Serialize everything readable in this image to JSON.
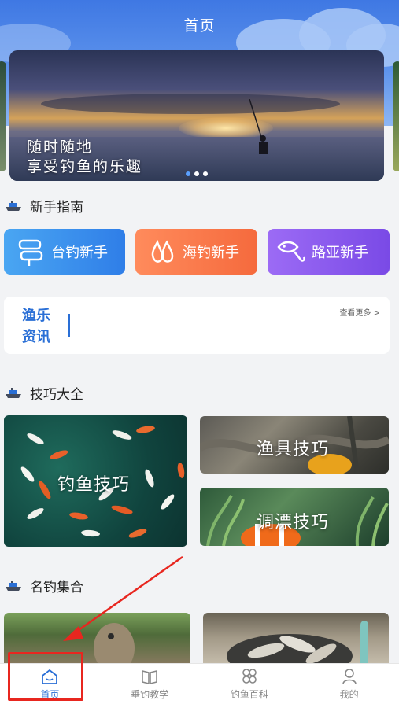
{
  "header": {
    "title": "首页"
  },
  "banner": {
    "line1": "随时随地",
    "line2": "享受钓鱼的乐趣",
    "pagination_count": 3,
    "active_index": 0
  },
  "sections": {
    "guide": {
      "title": "新手指南"
    },
    "skills": {
      "title": "技巧大全"
    },
    "famous": {
      "title": "名钓集合"
    }
  },
  "guide_buttons": [
    {
      "label": "台钓新手",
      "icon": "signpost-icon",
      "color": "#3a8ff0"
    },
    {
      "label": "海钓新手",
      "icon": "water-drops-icon",
      "color": "#f7794a"
    },
    {
      "label": "路亚新手",
      "icon": "fish-hook-icon",
      "color": "#8a5cf0"
    }
  ],
  "news": {
    "label": "渔乐资讯",
    "more": "查看更多 >"
  },
  "skill_tiles": [
    {
      "label": "钓鱼技巧"
    },
    {
      "label": "渔具技巧"
    },
    {
      "label": "调漂技巧"
    }
  ],
  "tabbar": {
    "items": [
      {
        "label": "首页",
        "icon": "home-icon",
        "active": true
      },
      {
        "label": "垂钓教学",
        "icon": "book-icon",
        "active": false
      },
      {
        "label": "钓鱼百科",
        "icon": "grid-icon",
        "active": false
      },
      {
        "label": "我的",
        "icon": "user-icon",
        "active": false
      }
    ]
  },
  "colors": {
    "accent": "#2a6fd6",
    "header_gradient_top": "#3f78e3",
    "annotation": "#e8261f"
  }
}
